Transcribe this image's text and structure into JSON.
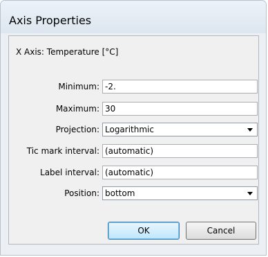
{
  "window": {
    "title": "Axis Properties"
  },
  "dialog": {
    "axis_label": "X Axis: Temperature [°C]",
    "fields": {
      "minimum": {
        "label": "Minimum:",
        "value": "-2."
      },
      "maximum": {
        "label": "Maximum:",
        "value": "30"
      },
      "projection": {
        "label": "Projection:",
        "value": "Logarithmic"
      },
      "tic_mark_interval": {
        "label": "Tic mark interval:",
        "value": "(automatic)"
      },
      "label_interval": {
        "label": "Label interval:",
        "value": "(automatic)"
      },
      "position": {
        "label": "Position:",
        "value": "bottom"
      }
    },
    "buttons": {
      "ok": "OK",
      "cancel": "Cancel"
    }
  }
}
